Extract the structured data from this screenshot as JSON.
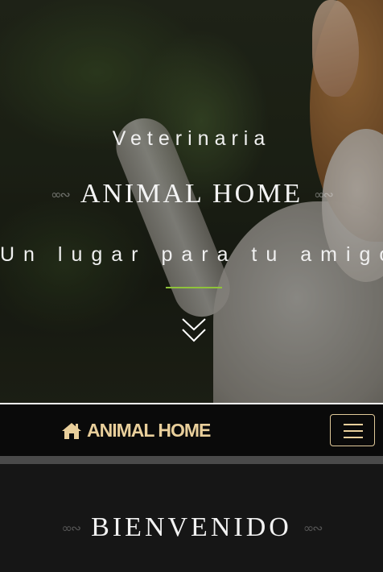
{
  "hero": {
    "kicker": "Veterinaria",
    "title": "ANIMAL HOME",
    "tagline": "Un lugar para tu amigo",
    "accent_color": "#8fc33a",
    "scroll_icon": "double-chevron-down-icon",
    "flourish": "∞∾"
  },
  "navbar": {
    "brand_icon": "home-icon",
    "brand_label": "ANIMAL HOME",
    "brand_color": "#e9cf9b",
    "toggler_icon": "hamburger-menu-icon"
  },
  "welcome": {
    "title": "BIENVENIDO",
    "flourish": "∞∾"
  }
}
